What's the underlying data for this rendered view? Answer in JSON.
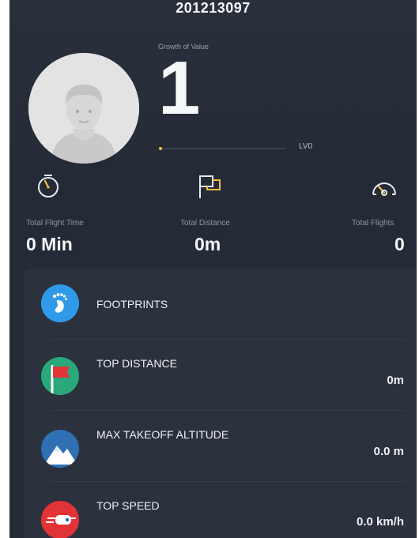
{
  "profile": {
    "username": "201213097",
    "growth_label": "Growth of Value",
    "level_value": "1",
    "level_label": "LV0",
    "progress_fraction": 0.02
  },
  "stats": [
    {
      "icon": "stopwatch-icon",
      "label": "Total Flight Time",
      "value": "0 Min"
    },
    {
      "icon": "flag-icon",
      "label": "Total Distance",
      "value": "0m"
    },
    {
      "icon": "speedometer-icon",
      "label": "Total Flights",
      "value": "0"
    }
  ],
  "records": [
    {
      "icon": "footprint-icon",
      "title": "FOOTPRINTS",
      "value": ""
    },
    {
      "icon": "red-flag-icon",
      "title": "TOP DISTANCE",
      "value": "0m"
    },
    {
      "icon": "mountain-icon",
      "title": "MAX TAKEOFF ALTITUDE",
      "value": "0.0 m"
    },
    {
      "icon": "drone-speed-icon",
      "title": "TOP SPEED",
      "value": "0.0 km/h"
    }
  ],
  "colors": {
    "background": "#252b36",
    "card": "#2b313d",
    "accent_yellow": "#f0c040",
    "footprint_blue": "#2f9ae8",
    "distance_green": "#2aa879",
    "altitude_blue": "#2f6fb4",
    "speed_red": "#e23437"
  }
}
